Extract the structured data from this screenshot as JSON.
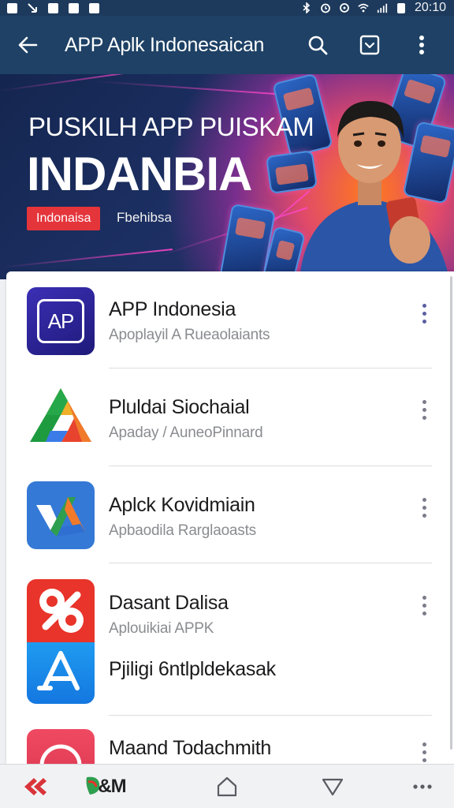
{
  "status_bar": {
    "time": "20:10"
  },
  "app_bar": {
    "title": "APP Aplk Indonesaican"
  },
  "banner": {
    "subtitle": "PUSKILH APP PUISKAM",
    "title": "INDANBIA",
    "tag": "Indonaisa",
    "tag_secondary": "Fbehibsa"
  },
  "apps": [
    {
      "name": "APP Indonesia",
      "subtitle": "Apoplayil A Rueaolaiants",
      "icon_text": "AP",
      "icon": "app-indonesia-icon"
    },
    {
      "name": "Pluldai Siochaial",
      "subtitle": "Apaday / AuneoPinnard",
      "icon": "triangle-drive-icon"
    },
    {
      "name": "Aplck Kovidmiain",
      "subtitle": "Apbaodila Rarglaoasts",
      "icon": "checkmark-triangle-icon"
    },
    {
      "name": "Dasant Dalisa",
      "subtitle": "Aplouikiai APPK",
      "icon": "pinwheel-icon"
    },
    {
      "name": "Pjiligi 6ntlpldekasak",
      "subtitle": "",
      "icon": "app-store-a-icon"
    },
    {
      "name": "Maand Todachmith",
      "subtitle": "",
      "icon": "red-circle-icon"
    }
  ],
  "bottom_nav": {
    "logo_text": "&M"
  },
  "colors": {
    "app_bar": "#1e4165",
    "status_bar": "#1d3a5c",
    "chip": "#e4353b",
    "menu_dots": "#7a7c88"
  }
}
